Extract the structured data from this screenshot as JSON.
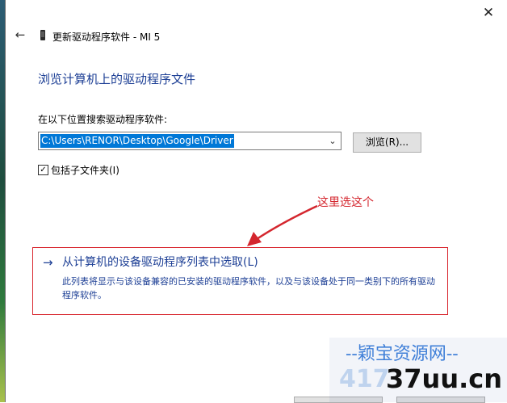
{
  "window": {
    "title": "更新驱动程序软件 - MI 5",
    "close_glyph": "✕",
    "back_glyph": "←"
  },
  "main": {
    "heading": "浏览计算机上的驱动程序文件",
    "search_label": "在以下位置搜索驱动程序软件:",
    "path_value": "C:\\Users\\RENOR\\Desktop\\Google\\Driver",
    "dropdown_glyph": "⌄",
    "browse_label": "浏览(R)...",
    "include_subfolders_label": "包括子文件夹(I)",
    "include_subfolders_checked": "✓"
  },
  "annotation": {
    "text": "这里选这个",
    "color": "#d4262e"
  },
  "option": {
    "arrow_glyph": "→",
    "title": "从计算机的设备驱动程序列表中选取(L)",
    "description": "此列表将显示与该设备兼容的已安装的驱动程序软件，以及与该设备处于同一类别下的所有驱动程序软件。"
  },
  "watermark": {
    "line1": "--颖宝资源网--",
    "digits": "417",
    "domain": "37uu.cn"
  },
  "colors": {
    "link_blue": "#1d3f95",
    "selection_blue": "#0078d7",
    "highlight_red": "#d8262e"
  }
}
